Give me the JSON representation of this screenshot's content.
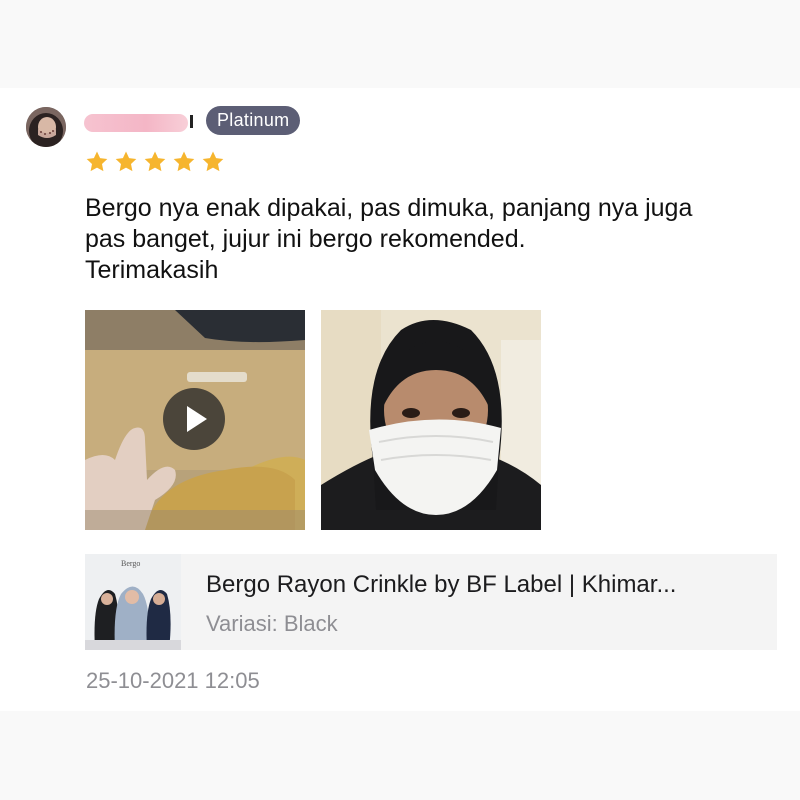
{
  "review": {
    "user": {
      "badge": "Platinum"
    },
    "rating": 5,
    "text_lines": [
      "Bergo nya enak dipakai, pas dimuka, panjang nya juga",
      "pas banget, jujur ini bergo rekomended.",
      "Terimakasih"
    ],
    "media": [
      {
        "type": "video",
        "icon": "play-icon"
      },
      {
        "type": "photo"
      }
    ],
    "product": {
      "name": "Bergo Rayon Crinkle by BF Label | Khimar...",
      "variant_label": "Variasi: ",
      "variant_value": "Black",
      "thumb_text": "Bergo"
    },
    "timestamp": "25-10-2021 12:05"
  },
  "colors": {
    "star": "#f6b52e",
    "badge_bg": "#5c5e75",
    "secondary_text": "#8e8e93",
    "product_bg": "#f4f4f4"
  }
}
